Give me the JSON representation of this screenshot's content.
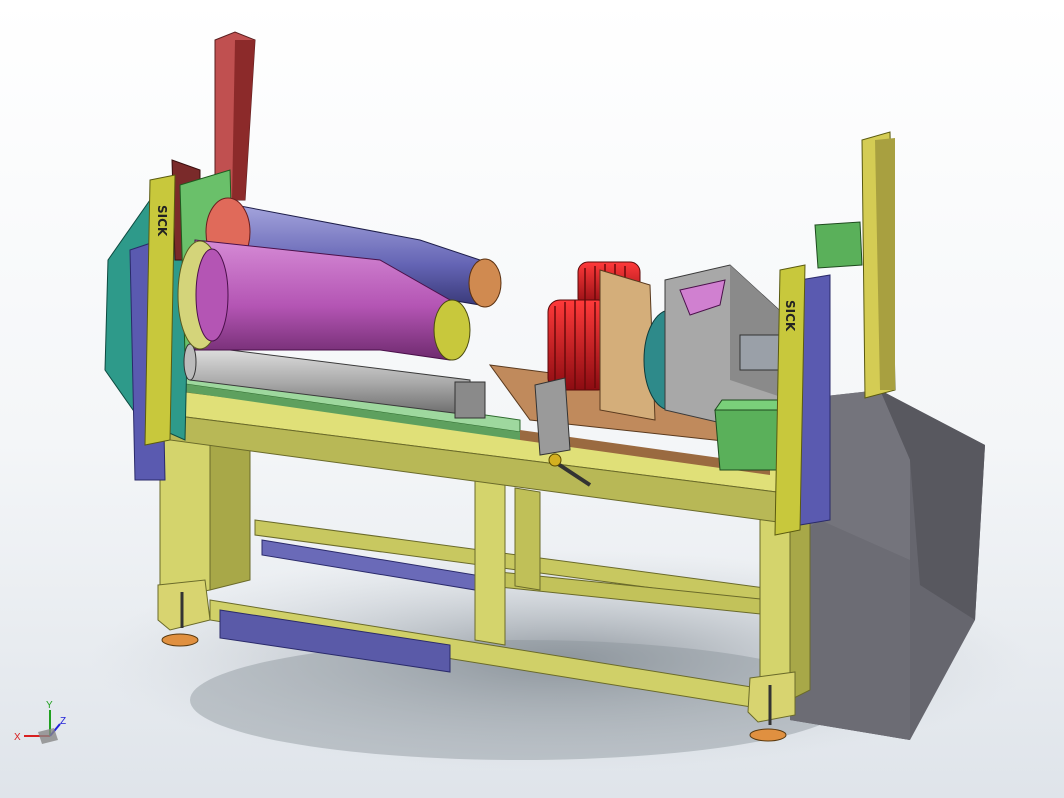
{
  "app": {
    "title": "",
    "view": "isometric-3d-model-viewport"
  },
  "model": {
    "light_curtain_label": "SICK",
    "colors": {
      "frame": "#cfcf6a",
      "frame_dark": "#9c9c44",
      "rail": "#8fcf8f",
      "blue_panel": "#5a5aa8",
      "red_gripper": "#d8202a",
      "magenta_cylinder": "#b455b4",
      "cabinet": "#6a6a74",
      "shadow": "#9aa2aa"
    }
  },
  "triad": {
    "x_label": "X",
    "y_label": "Y",
    "z_label": "Z"
  }
}
